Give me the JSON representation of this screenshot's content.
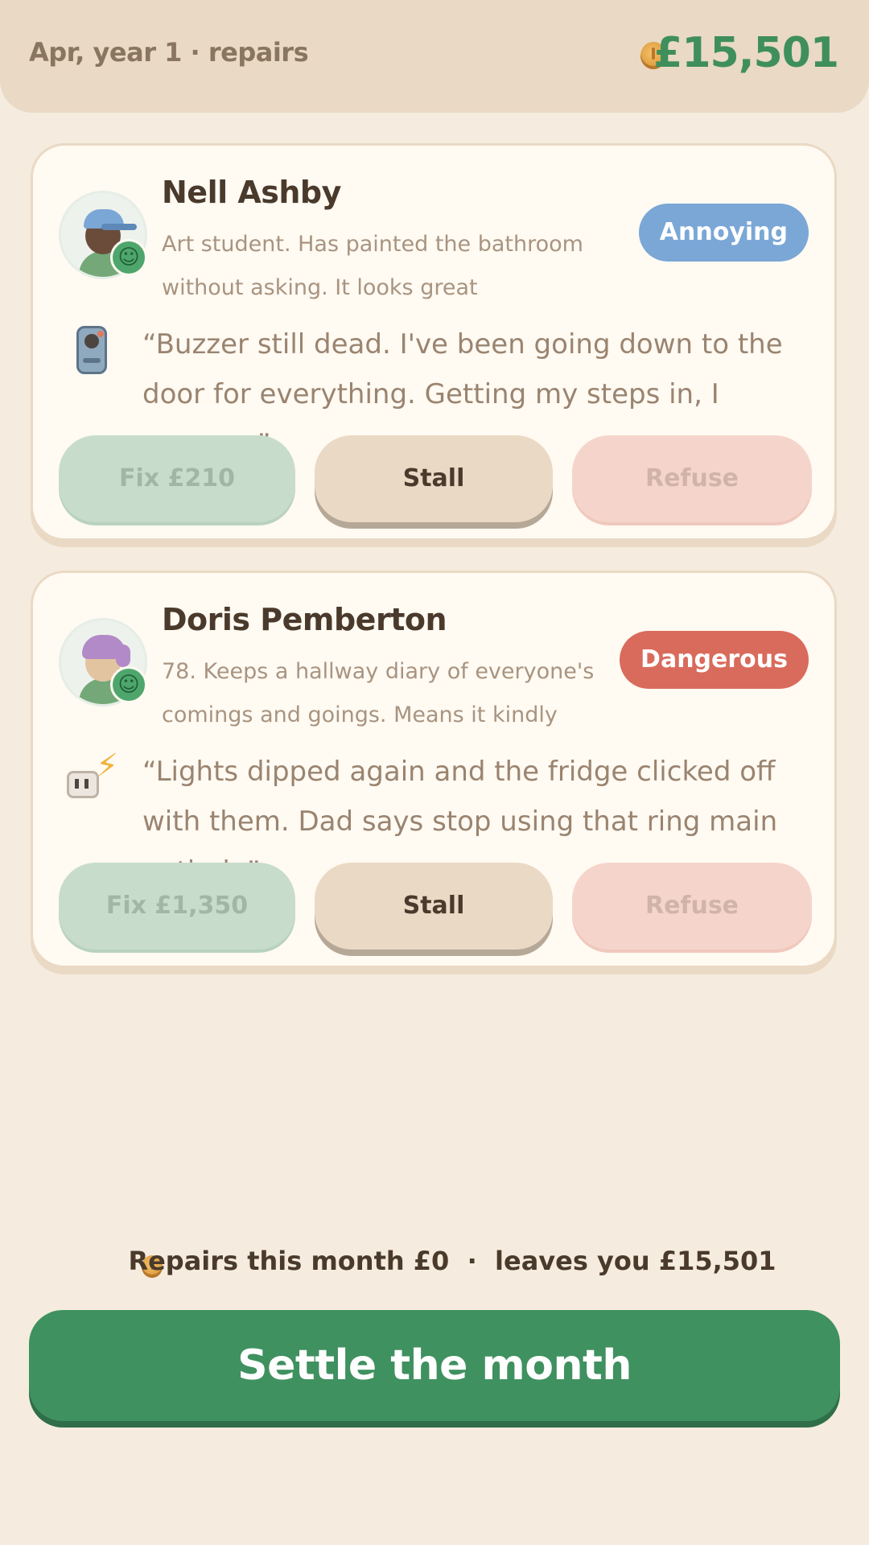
{
  "header": {
    "period": "Apr, year 1 · repairs",
    "balance": "£15,501"
  },
  "colors": {
    "money_green": "#3f8f5c",
    "annoying_badge": "#7aa7d6",
    "dangerous_badge": "#d96b5c",
    "settle_button": "#3f9160"
  },
  "tenants": [
    {
      "name": "Nell Ashby",
      "bio": "Art student. Has painted the bathroom without asking. It looks great",
      "mood_icon": "happy-face-icon",
      "badge": "Annoying",
      "issue_icon": "intercom-buzzer-icon",
      "complaint": "“Buzzer still dead. I've been going down to the door for everything. Getting my steps in, I suppose”",
      "fix_label": "Fix  £210",
      "stall_label": "Stall",
      "refuse_label": "Refuse"
    },
    {
      "name": "Doris Pemberton",
      "bio": "78. Keeps a hallway diary of everyone's comings and goings. Means it kindly",
      "mood_icon": "happy-face-icon",
      "badge": "Dangerous",
      "issue_icon": "electrical-socket-icon",
      "complaint": "“Lights dipped again and the fridge clicked off with them. Dad says stop using that ring main entirely”",
      "fix_label": "Fix  £1,350",
      "stall_label": "Stall",
      "refuse_label": "Refuse"
    }
  ],
  "summary": "Repairs this month £0  ·  leaves you £15,501",
  "settle_label": "Settle the month"
}
